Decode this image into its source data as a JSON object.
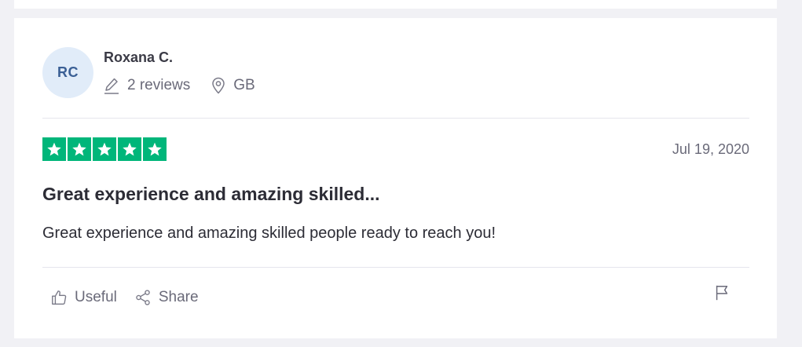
{
  "review": {
    "consumer": {
      "initials": "RC",
      "name": "Roxana C.",
      "reviews_count": "2 reviews",
      "location": "GB"
    },
    "rating": 5,
    "rating_color": "#00b67a",
    "date": "Jul 19, 2020",
    "title": "Great experience and amazing skilled...",
    "text": "Great experience and amazing skilled people ready to reach you!"
  },
  "actions": {
    "useful_label": "Useful",
    "share_label": "Share",
    "icons": [
      "thumbs-up-icon",
      "share-icon",
      "flag-icon"
    ]
  },
  "colors": {
    "avatar_bg": "#e1ecf9",
    "avatar_text": "#3a5f95",
    "page_bg": "#f1f1f5"
  }
}
